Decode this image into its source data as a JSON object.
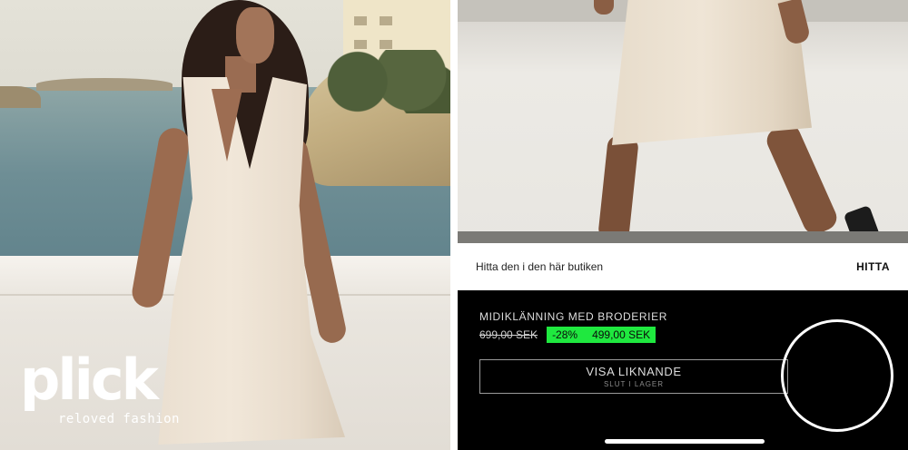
{
  "brand": {
    "name": "plick",
    "tagline": "reloved fashion"
  },
  "store_finder": {
    "text": "Hitta den i den här butiken",
    "button_label": "HITTA"
  },
  "product": {
    "name": "MIDIKLÄNNING MED BRODERIER",
    "original_price": "699,00 SEK",
    "discount": "-28%",
    "sale_price": "499,00 SEK"
  },
  "similar_button": {
    "label": "VISA LIKNANDE",
    "sublabel": "SLUT I LAGER"
  },
  "colors": {
    "sale_highlight": "#1fe83f",
    "info_background": "#000000",
    "logo_text": "#ffffff"
  }
}
